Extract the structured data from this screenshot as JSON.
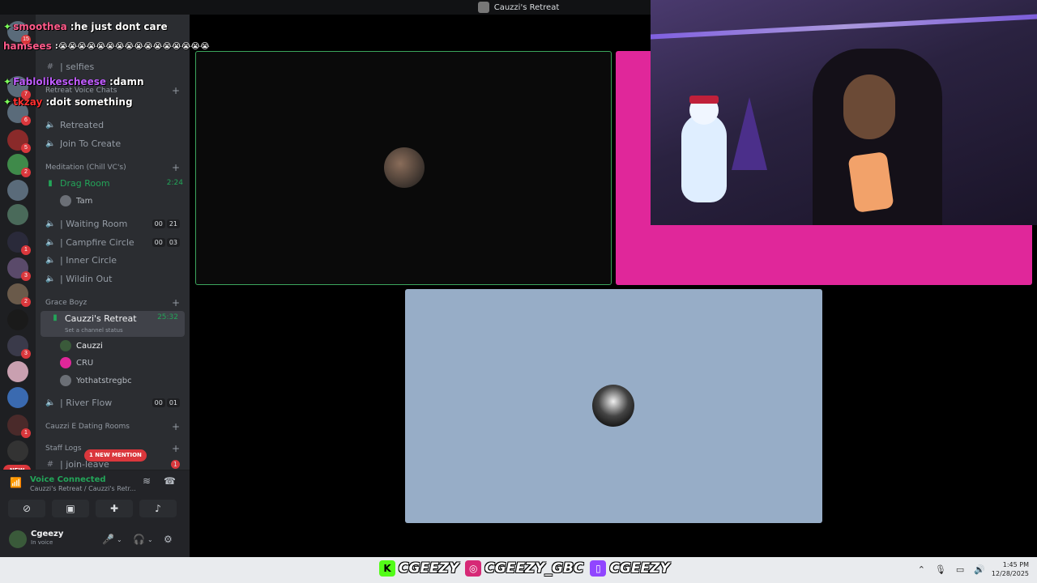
{
  "window": {
    "title": "Cauzzi's Retreat"
  },
  "chat": [
    {
      "name": "smoothea",
      "name_color": "#ff5a8a",
      "message": "he just dont care"
    },
    {
      "name": "hamsees",
      "name_color": "#ff5a8a",
      "message": "😭😭😭😭😭😭😭😭😭😭😭😭😭😭😭😭"
    },
    {
      "name": "Fablolikescheese",
      "name_color": "#c05cff",
      "message": "damn"
    },
    {
      "name": "tkzay",
      "name_color": "#ff3030",
      "message": "doit something"
    }
  ],
  "servers": {
    "badges": [
      "15",
      "7",
      "6",
      "5",
      "2",
      "1",
      "3",
      "2",
      "3",
      "1"
    ],
    "new_label": "NEW"
  },
  "sidebar": {
    "top_channel": "| selfies",
    "categories": {
      "retreat": "Retreat Voice Chats",
      "meditation": "Meditation (Chill VC's)",
      "grace": "Grace Boyz",
      "dating": "Cauzzi E Dating Rooms",
      "staff": "Staff Logs"
    },
    "channels": {
      "retreated": "Retreated",
      "join": "Join To Create",
      "drag": "Drag Room",
      "drag_timer": "2:24",
      "drag_user": "Tam",
      "waiting": "| Waiting Room",
      "waiting_cnt": [
        "00",
        "21"
      ],
      "campfire": "| Campfire Circle",
      "campfire_cnt": [
        "00",
        "03"
      ],
      "inner": "| Inner Circle",
      "wildin": "| Wildin Out",
      "cauzzi": "Cauzzi's Retreat",
      "cauzzi_timer": "25:32",
      "cauzzi_status": "Set a channel status",
      "cauzzi_users": [
        "Cauzzi",
        "CRU",
        "Yothatstregbc"
      ],
      "river": "| River Flow",
      "river_cnt": [
        "00",
        "01"
      ],
      "join_leave": "| join-leave",
      "join_leave_badge": "1"
    },
    "mention_pill": "1 NEW MENTION"
  },
  "voice": {
    "status": "Voice Connected",
    "channel": "Cauzzi's Retreat / Cauzzi's Retr..."
  },
  "user": {
    "name": "Cgeezy",
    "status": "In voice"
  },
  "brand": {
    "k": "CGEEZY",
    "ig": "CGEEZY_GBC",
    "tw": "CGEEZY"
  },
  "clock": {
    "time": "1:45 PM",
    "date": "12/28/2025"
  },
  "colors": {
    "speaking_border": "#3ba55c",
    "pink_tile": "#e0279a",
    "blue_tile": "#97adc7",
    "voice_green": "#23a559"
  }
}
